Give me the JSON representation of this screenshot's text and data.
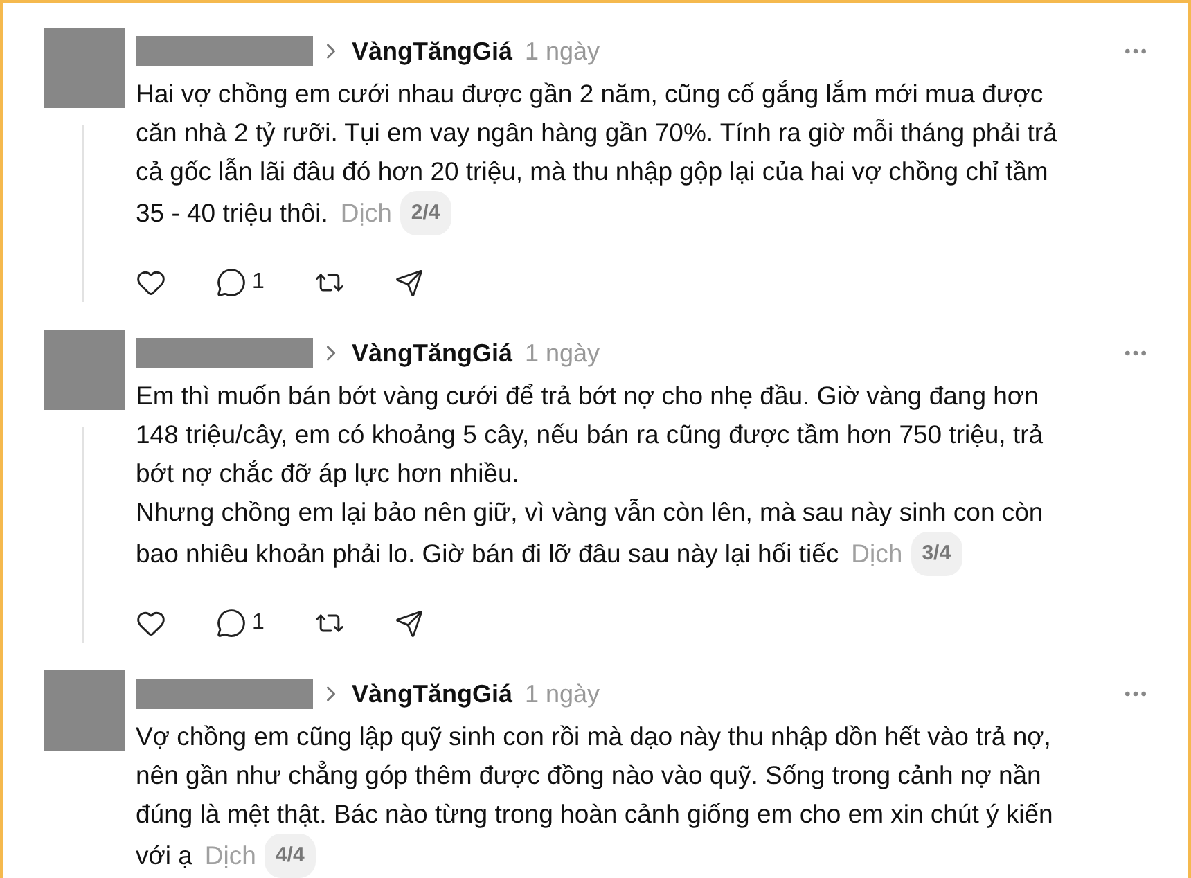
{
  "posts": [
    {
      "author": "VàngTăngGiá",
      "time": "1 ngày",
      "lines": [
        "Hai vợ chồng em cưới nhau được gần 2 năm, cũng cố gắng lắm mới mua được",
        "căn nhà 2 tỷ rưỡi. Tụi em vay ngân hàng gần 70%. Tính ra giờ mỗi tháng phải trả",
        "cả gốc lẫn lãi đâu đó hơn 20 triệu, mà thu nhập gộp lại của hai vợ chồng chỉ tầm",
        "35 - 40 triệu thôi."
      ],
      "translate": "Dịch",
      "page": "2/4",
      "reply_count": "1"
    },
    {
      "author": "VàngTăngGiá",
      "time": "1 ngày",
      "lines": [
        "Em thì muốn bán bớt vàng cưới để trả bớt nợ cho nhẹ đầu. Giờ vàng đang hơn",
        "148 triệu/cây, em có khoảng 5 cây, nếu bán ra cũng được tầm hơn 750 triệu, trả",
        "bớt nợ chắc đỡ áp lực hơn nhiều.",
        "Nhưng chồng em lại bảo nên giữ, vì vàng vẫn còn lên, mà sau này sinh con còn",
        "bao nhiêu khoản phải lo. Giờ bán đi lỡ đâu sau này lại hối tiếc"
      ],
      "translate": "Dịch",
      "page": "3/4",
      "reply_count": "1"
    },
    {
      "author": "VàngTăngGiá",
      "time": "1 ngày",
      "lines": [
        "Vợ chồng em cũng lập quỹ sinh con rồi mà dạo này thu nhập dồn hết vào trả nợ,",
        "nên gần như chẳng góp thêm được đồng nào vào quỹ. Sống trong cảnh nợ nần",
        "đúng là mệt thật. Bác nào từng trong hoàn cảnh giống em cho em xin chút ý kiến",
        "với ạ"
      ],
      "translate": "Dịch",
      "page": "4/4"
    }
  ]
}
